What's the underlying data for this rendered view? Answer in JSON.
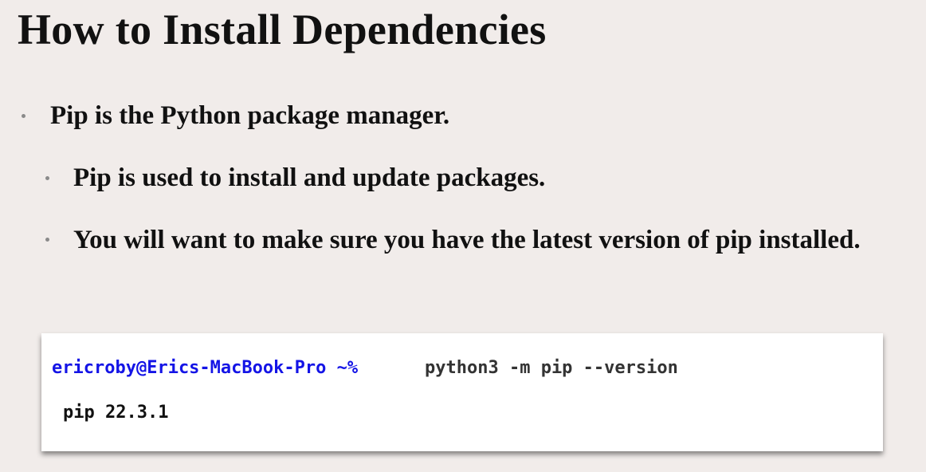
{
  "slide": {
    "title": "How to Install Dependencies",
    "bullets": [
      "Pip is the Python package manager.",
      "Pip is used to install and update packages.",
      "You will want to make sure you have the latest version of pip installed."
    ]
  },
  "terminal": {
    "prompt": "ericroby@Erics-MacBook-Pro ~%",
    "command": "python3 -m pip --version",
    "output": "pip 22.3.1",
    "prompt_color": "#1414e6"
  }
}
